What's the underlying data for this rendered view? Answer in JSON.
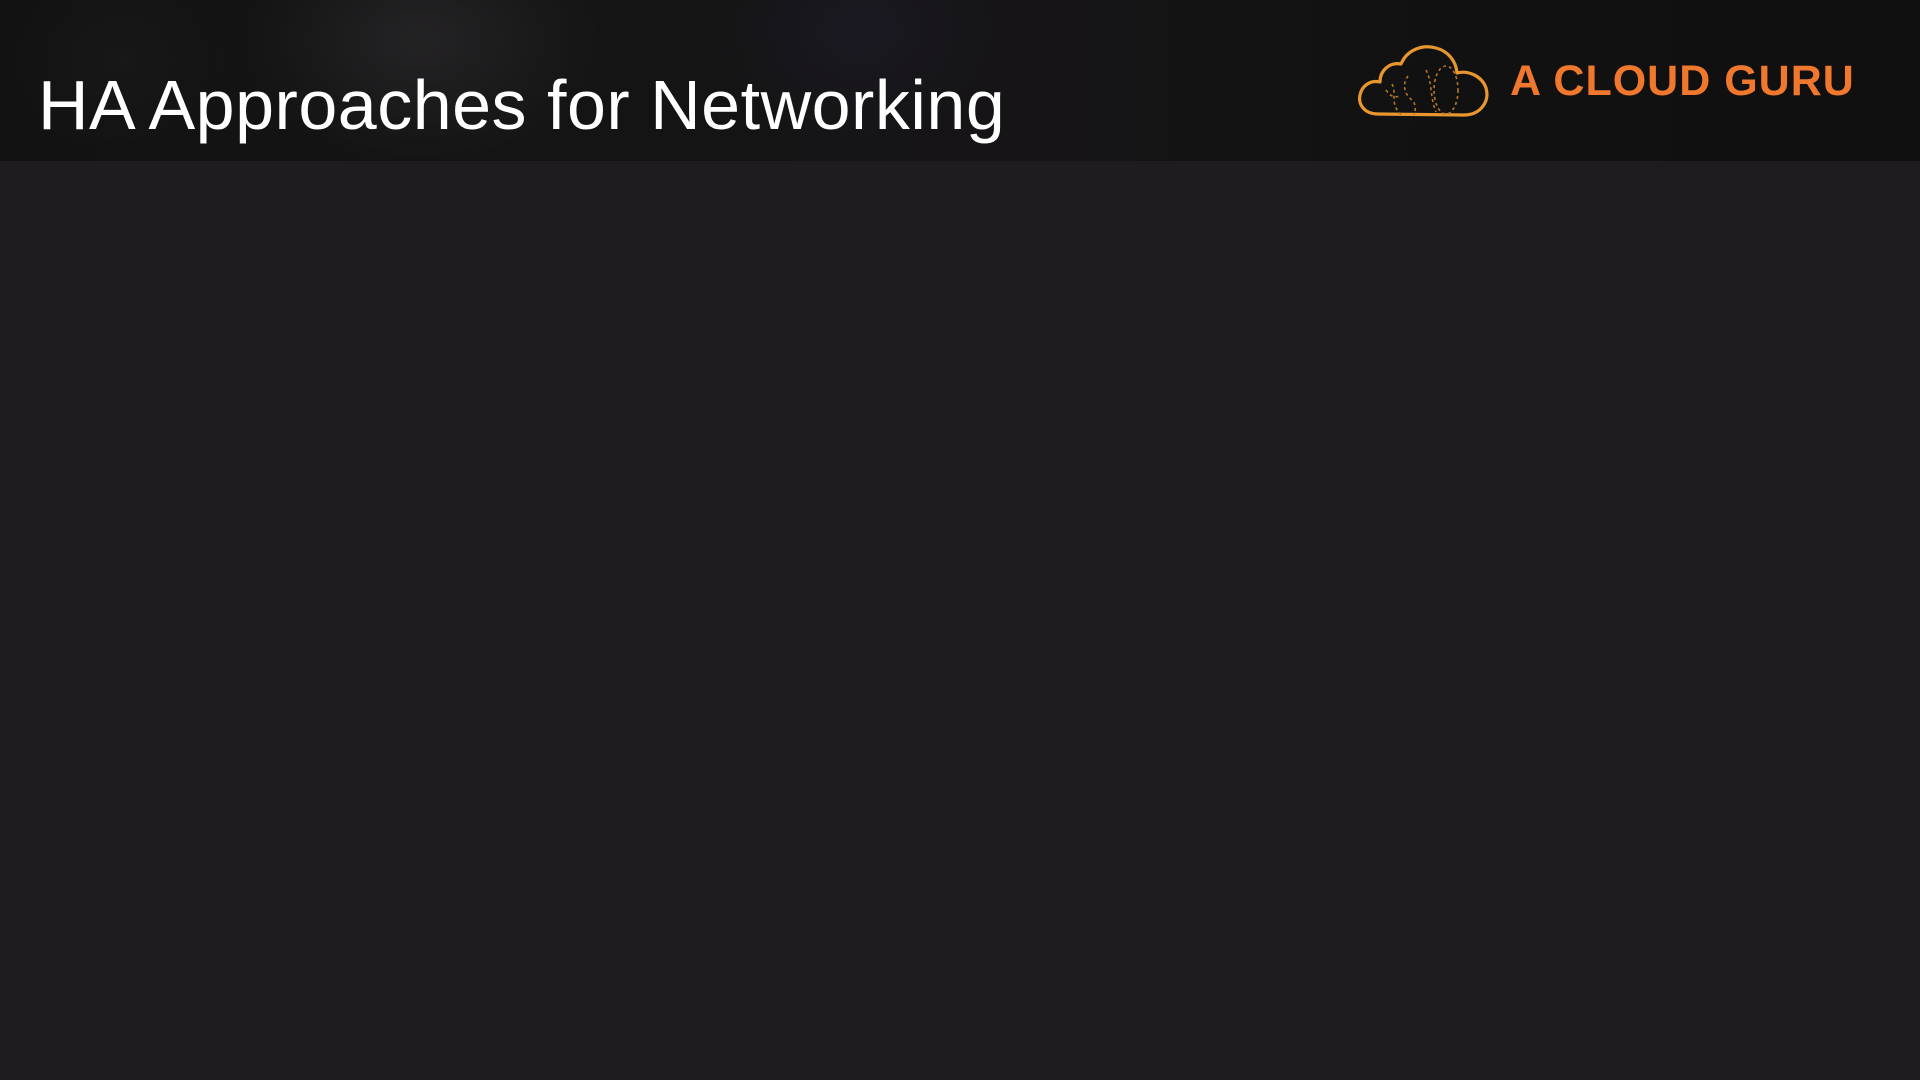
{
  "slide": {
    "title": "HA Approaches for Networking"
  },
  "brand": {
    "name": "A CLOUD GURU",
    "icon": "cloud-icon",
    "color": "#f0782e",
    "icon_color": "#e8972f"
  },
  "colors": {
    "background": "#1e1c1f",
    "title_text": "#ffffff"
  }
}
